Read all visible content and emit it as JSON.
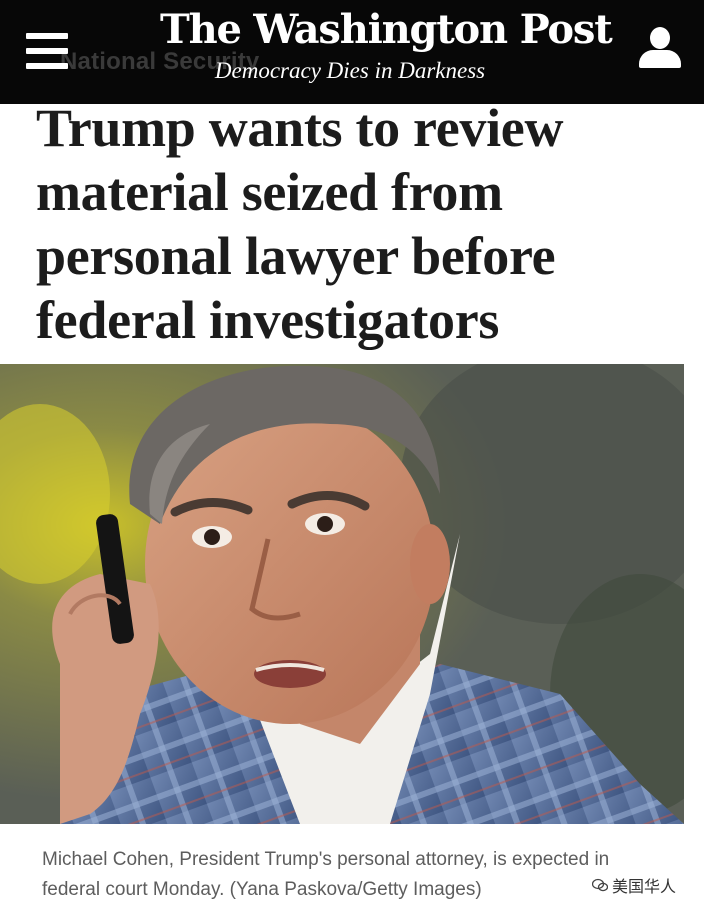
{
  "header": {
    "section": "National Security",
    "logo": "The Washington Post",
    "tagline": "Democracy Dies in Darkness",
    "menu_icon": "hamburger-menu-icon",
    "account_icon": "user-account-icon",
    "background": "#070707"
  },
  "article": {
    "headline": "Trump wants to review material seized from personal lawyer before federal investigators",
    "photo_caption": "Michael Cohen, President Trump's personal attorney, is expected in federal court Monday. (Yana Paskova/Getty Images)"
  },
  "watermark": {
    "text": "美国华人"
  }
}
